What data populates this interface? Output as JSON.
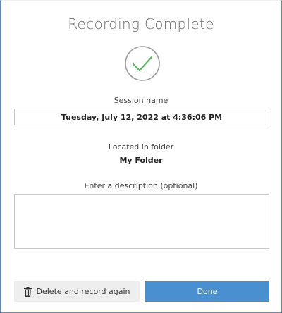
{
  "dialog": {
    "title": "Recording Complete",
    "status_icon": "checkmark-circle-icon",
    "accent_color": "#4a90d0",
    "success_color": "#5cb85c"
  },
  "session": {
    "label": "Session name",
    "value": "Tuesday, July 12, 2022 at 4:36:06 PM"
  },
  "folder": {
    "label": "Located in folder",
    "value": "My Folder"
  },
  "description": {
    "label": "Enter a description (optional)",
    "value": ""
  },
  "actions": {
    "delete_label": "Delete and record again",
    "delete_icon": "trash-icon",
    "done_label": "Done"
  }
}
